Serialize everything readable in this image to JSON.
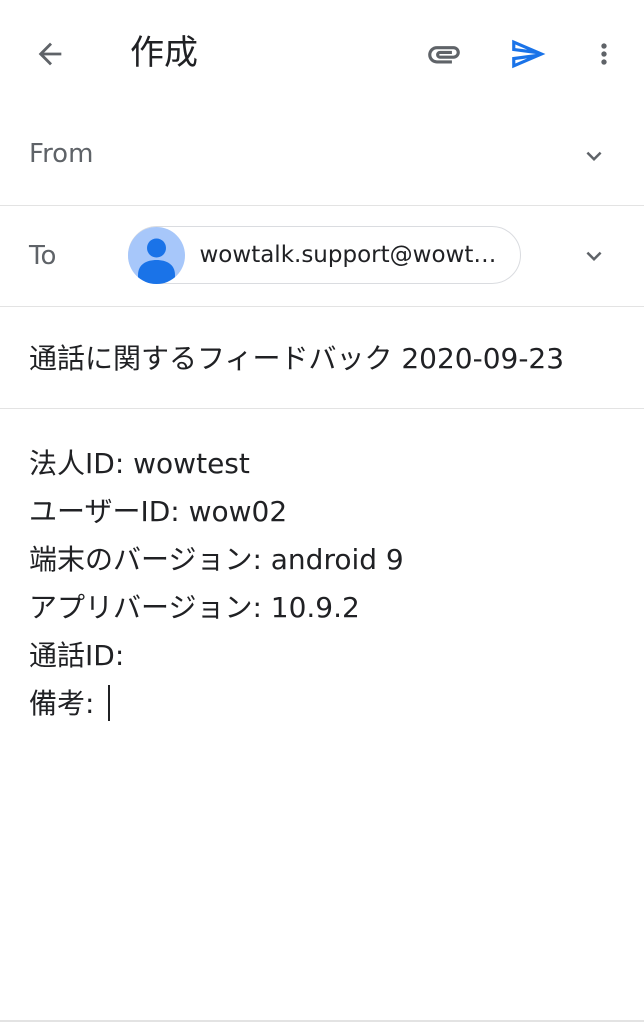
{
  "appbar": {
    "title": "作成",
    "back_icon": "arrow-back-icon",
    "attach_icon": "paperclip-icon",
    "send_icon": "send-icon",
    "more_icon": "more-vert-icon",
    "send_color": "#1a73e8"
  },
  "from": {
    "label": "From",
    "chevron_icon": "chevron-down-icon"
  },
  "to": {
    "label": "To",
    "recipient": "wowtalk.support@wowte...",
    "avatar_icon": "person-avatar-icon",
    "chevron_icon": "chevron-down-icon"
  },
  "subject": {
    "value": "通話に関するフィードバック 2020-09-23"
  },
  "body": {
    "lines": [
      "法人ID: wowtest",
      "ユーザーID: wow02",
      "端末のバージョン: android 9",
      "アプリバージョン: 10.9.2",
      "通話ID:",
      "備考:"
    ]
  }
}
